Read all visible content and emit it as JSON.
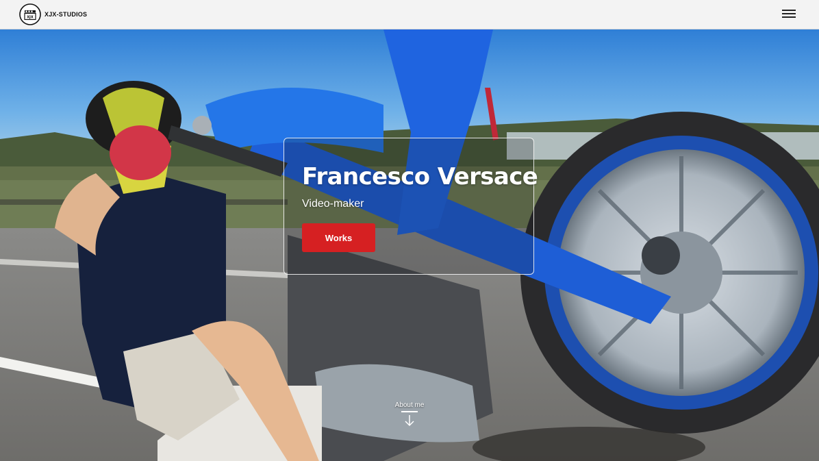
{
  "header": {
    "logo_icon": "film-clapperboard-icon",
    "logo_mark_text": "XJX",
    "brand": "XJX-STUDIOS",
    "menu_icon": "hamburger-menu-icon"
  },
  "hero": {
    "background_image": "person-riding-wheelie-blue-motorbike-photo",
    "title": "Francesco Versace",
    "subtitle": "Video-maker",
    "cta_label": "Works",
    "cta_color": "#d62022"
  },
  "about": {
    "label": "About me",
    "icon": "arrow-down-icon"
  }
}
